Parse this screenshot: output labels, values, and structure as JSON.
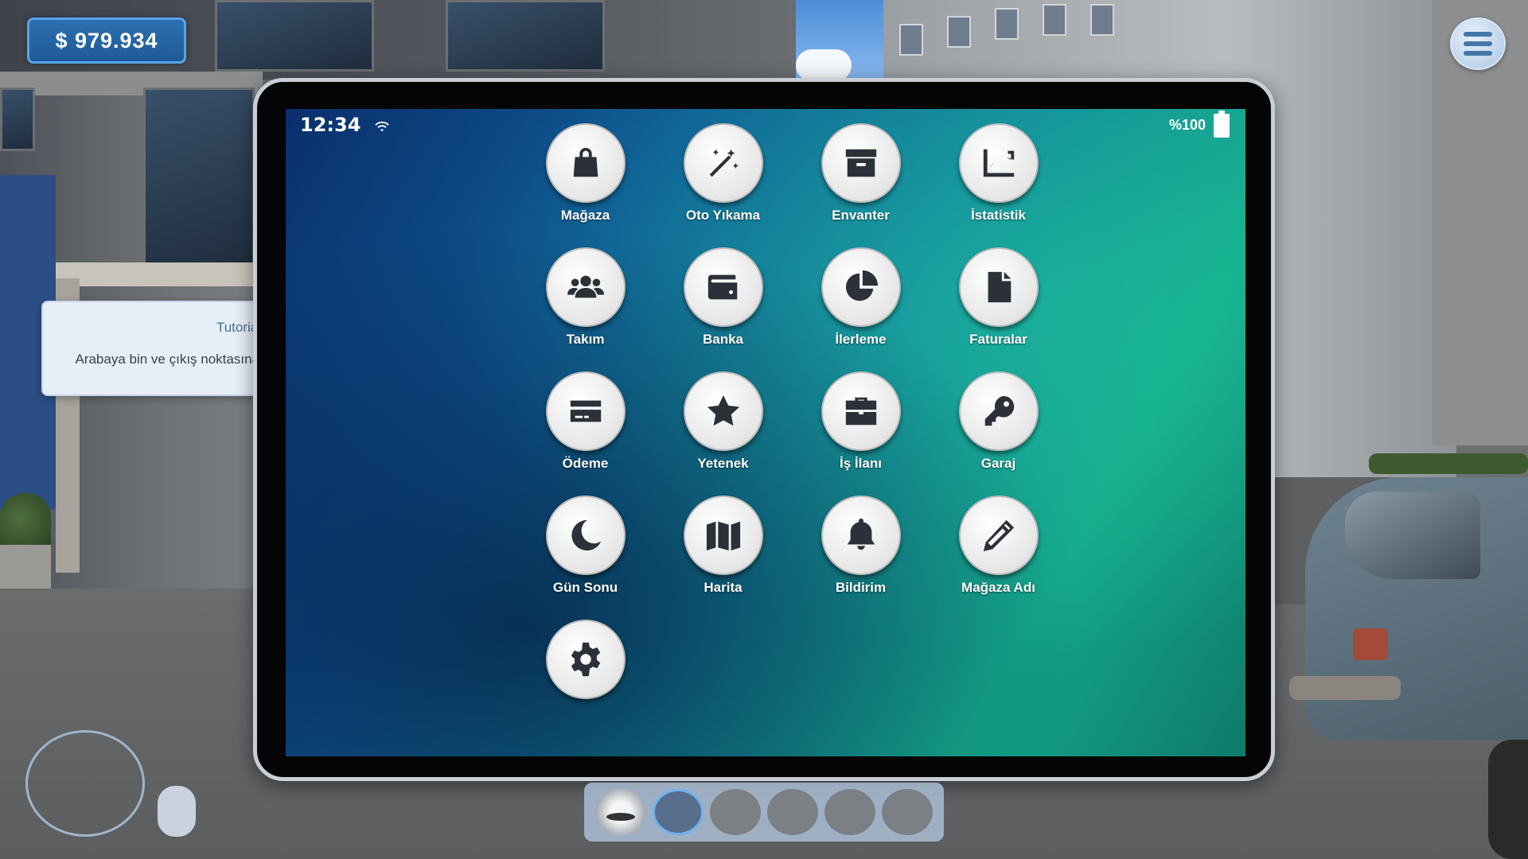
{
  "hud": {
    "money": "$ 979.934",
    "menu_icon": "hamburger-icon"
  },
  "tutorial": {
    "title": "Tutorial",
    "text": "Arabaya bin ve çıkış noktasına sürerek iş sahasına git."
  },
  "tablet": {
    "status": {
      "time": "12:34",
      "battery": "%100"
    },
    "apps": [
      {
        "label": "Mağaza",
        "icon": "shopping-bag-icon"
      },
      {
        "label": "Oto Yıkama",
        "icon": "magic-wand-icon"
      },
      {
        "label": "Envanter",
        "icon": "archive-box-icon"
      },
      {
        "label": "İstatistik",
        "icon": "chart-line-icon"
      },
      {
        "label": "Takım",
        "icon": "users-icon"
      },
      {
        "label": "Banka",
        "icon": "wallet-icon"
      },
      {
        "label": "İlerleme",
        "icon": "pie-chart-icon"
      },
      {
        "label": "Faturalar",
        "icon": "document-icon"
      },
      {
        "label": "Ödeme",
        "icon": "credit-card-icon"
      },
      {
        "label": "Yetenek",
        "icon": "star-icon"
      },
      {
        "label": "İş İlanı",
        "icon": "briefcase-icon"
      },
      {
        "label": "Garaj",
        "icon": "key-icon"
      },
      {
        "label": "Gün Sonu",
        "icon": "moon-icon"
      },
      {
        "label": "Harita",
        "icon": "map-icon"
      },
      {
        "label": "Bildirim",
        "icon": "bell-icon"
      },
      {
        "label": "Mağaza Adı",
        "icon": "pencil-icon"
      },
      {
        "label": "",
        "icon": "gear-icon"
      }
    ]
  },
  "dock": {
    "slots": 6,
    "active_slot": 2
  },
  "colors": {
    "money_bg": "#2c6fb0",
    "accent": "#56a4ea",
    "icon_fill": "#2c3038"
  }
}
